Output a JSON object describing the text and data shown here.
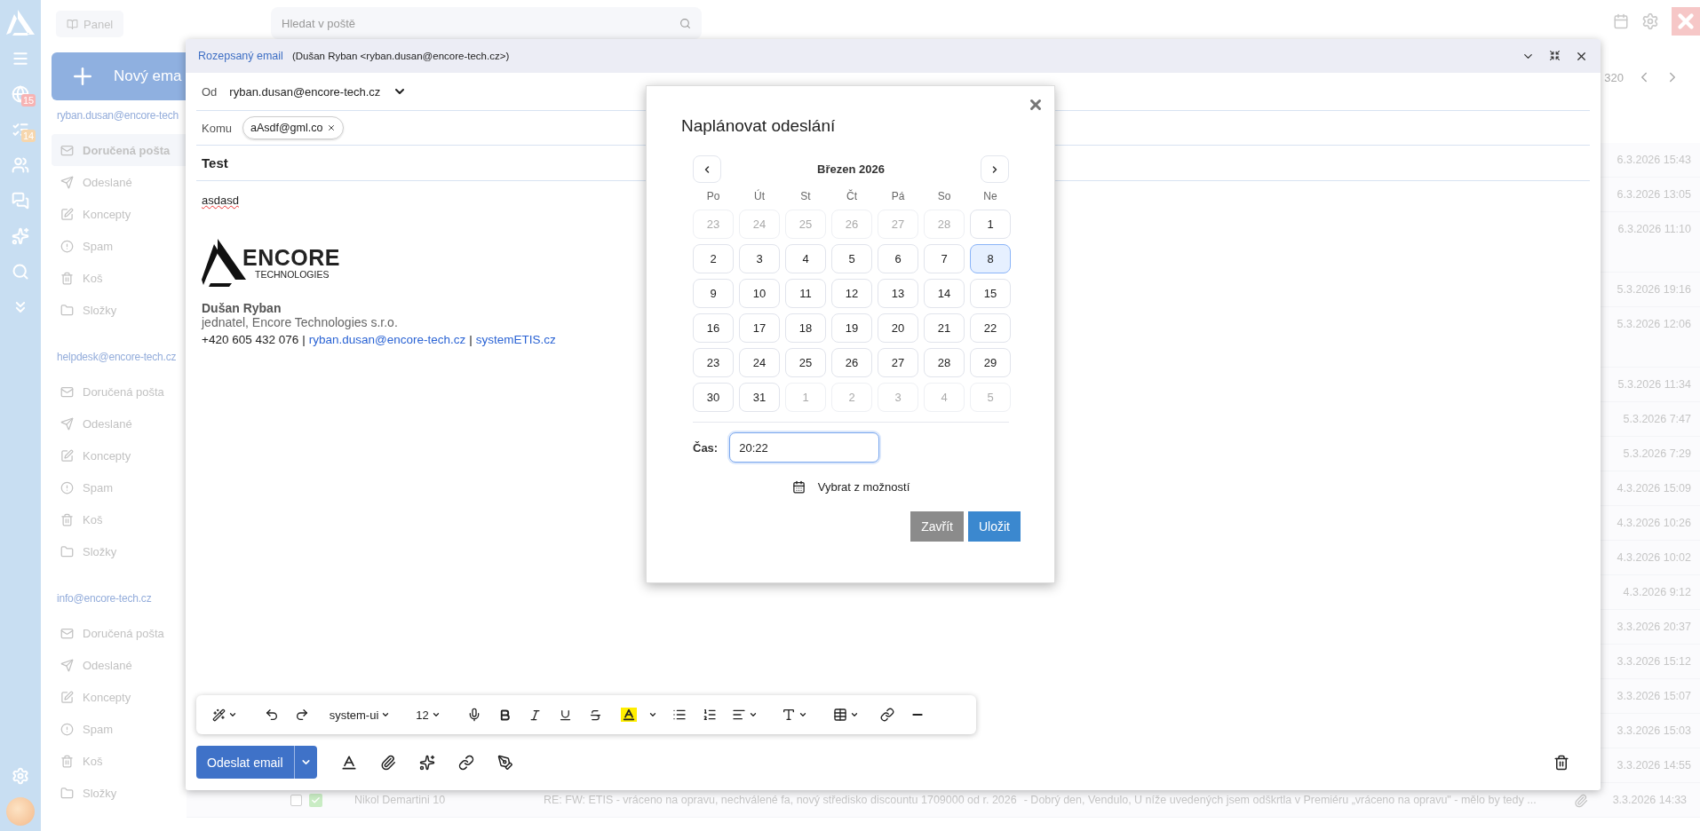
{
  "rail": {
    "badges": [
      {
        "text": "15",
        "color": "#f7b3b3"
      },
      {
        "text": "14",
        "color": "#f6d6ad"
      }
    ]
  },
  "panel_button": "Panel",
  "new_email_button": "Nový ema",
  "accounts": [
    {
      "address": "ryban.dusan@encore-tech",
      "folders": [
        {
          "kind": "inbox",
          "label": "Doručená pošta",
          "selected": true
        },
        {
          "kind": "sent",
          "label": "Odeslané",
          "selected": false
        },
        {
          "kind": "drafts",
          "label": "Koncepty",
          "selected": false
        },
        {
          "kind": "spam",
          "label": "Spam",
          "selected": false
        },
        {
          "kind": "trash",
          "label": "Koš",
          "selected": false
        },
        {
          "kind": "folders",
          "label": "Složky",
          "selected": false
        }
      ]
    },
    {
      "address": "helpdesk@encore-tech.cz",
      "folders": [
        {
          "kind": "inbox",
          "label": "Doručená pošta",
          "selected": false
        },
        {
          "kind": "sent",
          "label": "Odeslané",
          "selected": false
        },
        {
          "kind": "drafts",
          "label": "Koncepty",
          "selected": false
        },
        {
          "kind": "spam",
          "label": "Spam",
          "selected": false
        },
        {
          "kind": "trash",
          "label": "Koš",
          "selected": false
        },
        {
          "kind": "folders",
          "label": "Složky",
          "selected": false
        }
      ]
    },
    {
      "address": "info@encore-tech.cz",
      "folders": [
        {
          "kind": "inbox",
          "label": "Doručená pošta",
          "selected": false
        },
        {
          "kind": "sent",
          "label": "Odeslané",
          "selected": false
        },
        {
          "kind": "drafts",
          "label": "Koncepty",
          "selected": false
        },
        {
          "kind": "spam",
          "label": "Spam",
          "selected": false
        },
        {
          "kind": "trash",
          "label": "Koš",
          "selected": false
        },
        {
          "kind": "folders",
          "label": "Složky",
          "selected": false
        }
      ]
    }
  ],
  "search": {
    "placeholder": "Hledat v poště"
  },
  "pager": {
    "count": "320"
  },
  "messages": [
    {
      "kind": "single",
      "date": "6.3.2026 15:43"
    },
    {
      "kind": "single",
      "date": "6.3.2026 13:05"
    },
    {
      "kind": "double",
      "date": "6.3.2026 11:10"
    },
    {
      "kind": "single",
      "date": "5.3.2026 19:16"
    },
    {
      "kind": "double",
      "date": "5.3.2026 12:06"
    },
    {
      "kind": "single",
      "date": "5.3.2026 11:34"
    },
    {
      "kind": "single",
      "date": "5.3.2026 7:47"
    },
    {
      "kind": "single",
      "date": "5.3.2026 7:29"
    },
    {
      "kind": "single",
      "date": "4.3.2026 15:09"
    },
    {
      "kind": "single",
      "date": "4.3.2026 10:26"
    },
    {
      "kind": "single",
      "date": "4.3.2026 10:02"
    },
    {
      "kind": "single",
      "date": "4.3.2026 9:12"
    },
    {
      "kind": "single",
      "date": "3.3.2026 20:37"
    },
    {
      "kind": "single",
      "date": "3.3.2026 15:12"
    },
    {
      "kind": "single",
      "date": "3.3.2026 15:07"
    },
    {
      "kind": "single",
      "date": "3.3.2026 15:03"
    },
    {
      "kind": "single",
      "date": "3.3.2026 14:55"
    },
    {
      "kind": "full",
      "date": "3.3.2026 14:33",
      "checked": false,
      "sender": "Nikol Demartini 10",
      "subject": "RE: FW: ETIS - vráceno na opravu, nechválené fa, nový středisko discountu 1709000 od r. 2026",
      "preview": "- Dobrý den, Vendulo, U níže uvedených jsem odškrtla v Premiéru „vráceno na opravu\" - mělo by tedy ..."
    }
  ],
  "compose": {
    "title": "Rozepsaný email",
    "sender_info": "(Dušan Ryban <ryban.dusan@encore-tech.cz>)",
    "from_label": "Od",
    "from_value": "ryban.dusan@encore-tech.cz",
    "to_label": "Komu",
    "recipients": [
      "aAsdf@gml.co"
    ],
    "subject": "Test",
    "body": "asdasd",
    "signature": {
      "logo_main": "ENCORE",
      "logo_sub": "TECHNOLOGIES",
      "name": "Dušan Ryban",
      "role": "jednatel, Encore Technologies s.r.o.",
      "phone": "+420 605 432 076",
      "separator": "|",
      "email": "ryban.dusan@encore-tech.cz",
      "web": "systemETIS.cz"
    },
    "toolbar": {
      "font": "system-ui",
      "size": "12"
    },
    "send_button": "Odeslat email"
  },
  "schedule_dialog": {
    "title": "Naplánovat odeslání",
    "month": "Březen 2026",
    "weekdays": [
      "Po",
      "Út",
      "St",
      "Čt",
      "Pá",
      "So",
      "Ne"
    ],
    "days": [
      {
        "label": "23",
        "outside": true,
        "selected": false
      },
      {
        "label": "24",
        "outside": true,
        "selected": false
      },
      {
        "label": "25",
        "outside": true,
        "selected": false
      },
      {
        "label": "26",
        "outside": true,
        "selected": false
      },
      {
        "label": "27",
        "outside": true,
        "selected": false
      },
      {
        "label": "28",
        "outside": true,
        "selected": false
      },
      {
        "label": "1",
        "outside": false,
        "selected": false
      },
      {
        "label": "2",
        "outside": false,
        "selected": false
      },
      {
        "label": "3",
        "outside": false,
        "selected": false
      },
      {
        "label": "4",
        "outside": false,
        "selected": false
      },
      {
        "label": "5",
        "outside": false,
        "selected": false
      },
      {
        "label": "6",
        "outside": false,
        "selected": false
      },
      {
        "label": "7",
        "outside": false,
        "selected": false
      },
      {
        "label": "8",
        "outside": false,
        "selected": true
      },
      {
        "label": "9",
        "outside": false,
        "selected": false
      },
      {
        "label": "10",
        "outside": false,
        "selected": false
      },
      {
        "label": "11",
        "outside": false,
        "selected": false
      },
      {
        "label": "12",
        "outside": false,
        "selected": false
      },
      {
        "label": "13",
        "outside": false,
        "selected": false
      },
      {
        "label": "14",
        "outside": false,
        "selected": false
      },
      {
        "label": "15",
        "outside": false,
        "selected": false
      },
      {
        "label": "16",
        "outside": false,
        "selected": false
      },
      {
        "label": "17",
        "outside": false,
        "selected": false
      },
      {
        "label": "18",
        "outside": false,
        "selected": false
      },
      {
        "label": "19",
        "outside": false,
        "selected": false
      },
      {
        "label": "20",
        "outside": false,
        "selected": false
      },
      {
        "label": "21",
        "outside": false,
        "selected": false
      },
      {
        "label": "22",
        "outside": false,
        "selected": false
      },
      {
        "label": "23",
        "outside": false,
        "selected": false
      },
      {
        "label": "24",
        "outside": false,
        "selected": false
      },
      {
        "label": "25",
        "outside": false,
        "selected": false
      },
      {
        "label": "26",
        "outside": false,
        "selected": false
      },
      {
        "label": "27",
        "outside": false,
        "selected": false
      },
      {
        "label": "28",
        "outside": false,
        "selected": false
      },
      {
        "label": "29",
        "outside": false,
        "selected": false
      },
      {
        "label": "30",
        "outside": false,
        "selected": false
      },
      {
        "label": "31",
        "outside": false,
        "selected": false
      },
      {
        "label": "1",
        "outside": true,
        "selected": false
      },
      {
        "label": "2",
        "outside": true,
        "selected": false
      },
      {
        "label": "3",
        "outside": true,
        "selected": false
      },
      {
        "label": "4",
        "outside": true,
        "selected": false
      },
      {
        "label": "5",
        "outside": true,
        "selected": false
      }
    ],
    "time_label": "Čas:",
    "time_value": "20:22",
    "options_link": "Vybrat z možností",
    "buttons": [
      {
        "kind": "secondary",
        "label": "Zavřít"
      },
      {
        "kind": "primary",
        "label": "Uložit"
      }
    ]
  }
}
